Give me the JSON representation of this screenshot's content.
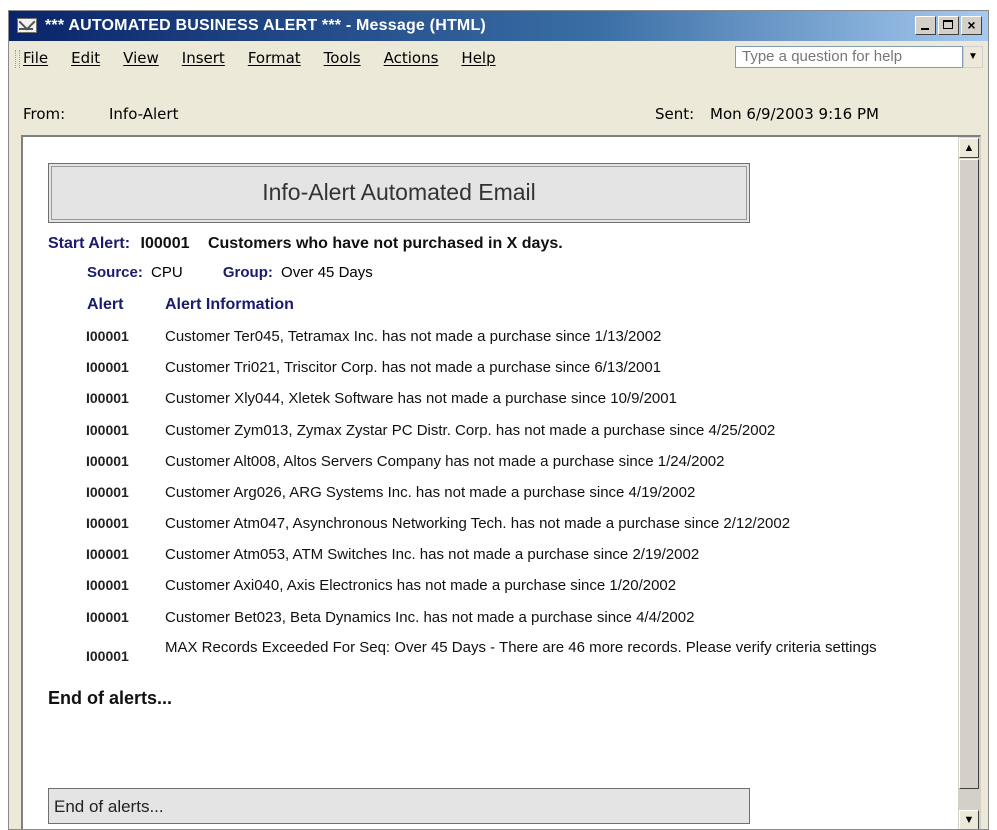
{
  "window": {
    "title": "*** AUTOMATED BUSINESS ALERT *** - Message (HTML)",
    "controls": {
      "minimize": "_",
      "maximize": "□",
      "close": "×"
    }
  },
  "menu": {
    "items": [
      "File",
      "Edit",
      "View",
      "Insert",
      "Format",
      "Tools",
      "Actions",
      "Help"
    ],
    "help_placeholder": "Type a question for help"
  },
  "header": {
    "from_label": "From:",
    "from_value": "Info-Alert",
    "sent_label": "Sent:",
    "sent_value": "Mon 6/9/2003 9:16 PM"
  },
  "email": {
    "banner_title": "Info-Alert Automated Email",
    "start_alert_label": "Start Alert:",
    "alert_id": "I00001",
    "alert_description": "Customers who have not purchased in X days.",
    "source_label": "Source:",
    "source_value": "CPU",
    "group_label": "Group:",
    "group_value": "Over 45 Days",
    "col_alert": "Alert",
    "col_info": "Alert Information",
    "rows": [
      {
        "id": "I00001",
        "info": "Customer Ter045, Tetramax Inc. has not made a purchase since 1/13/2002"
      },
      {
        "id": "I00001",
        "info": "Customer Tri021, Triscitor Corp. has not made a purchase since 6/13/2001"
      },
      {
        "id": "I00001",
        "info": "Customer Xly044, Xletek Software has not made a purchase since 10/9/2001"
      },
      {
        "id": "I00001",
        "info": "Customer Zym013, Zymax Zystar PC Distr. Corp. has not made a purchase since 4/25/2002"
      },
      {
        "id": "I00001",
        "info": "Customer Alt008, Altos Servers Company has not made a purchase since 1/24/2002"
      },
      {
        "id": "I00001",
        "info": "Customer Arg026, ARG Systems Inc. has not made a purchase since 4/19/2002"
      },
      {
        "id": "I00001",
        "info": "Customer Atm047, Asynchronous Networking Tech. has not made a purchase since 2/12/2002"
      },
      {
        "id": "I00001",
        "info": "Customer Atm053, ATM Switches Inc. has not made a purchase since 2/19/2002"
      },
      {
        "id": "I00001",
        "info": "Customer Axi040, Axis Electronics has not made a purchase since 1/20/2002"
      },
      {
        "id": "I00001",
        "info": "Customer Bet023, Beta Dynamics Inc. has not made a purchase since 4/4/2002"
      },
      {
        "id": "I00001",
        "info": "MAX Records Exceeded For Seq: Over 45 Days - There are 46 more records. Please verify criteria settings"
      }
    ],
    "end_text": "End of alerts...",
    "footer_text": "End of alerts..."
  },
  "scroll": {
    "up_glyph": "▲",
    "down_glyph": "▼"
  }
}
